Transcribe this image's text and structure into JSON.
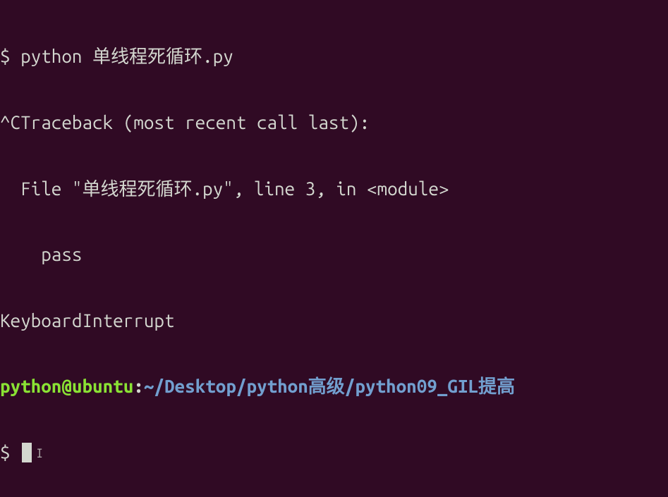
{
  "terminal": {
    "lines": {
      "command": "$ python 单线程死循环.py",
      "traceback_header": "^CTraceback (most recent call last):",
      "traceback_file": "  File \"单线程死循环.py\", line 3, in <module>",
      "traceback_code": "    pass",
      "interrupt": "KeyboardInterrupt"
    },
    "prompt": {
      "user_host": "python@ubuntu",
      "colon": ":",
      "path": "~/Desktop/python高级/python09_GIL提高",
      "symbol": "$ "
    }
  }
}
